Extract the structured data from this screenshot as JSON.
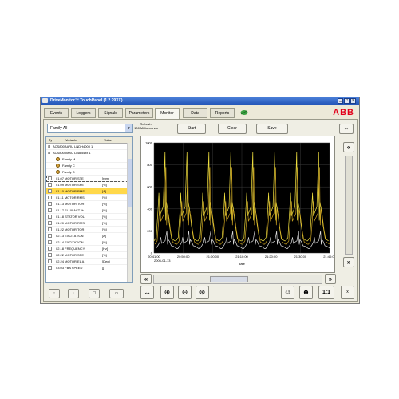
{
  "window": {
    "title": "DriveMonitor™ TouchPanel (1.2.29XX)"
  },
  "tabs": [
    "Events",
    "Loggers",
    "Signals",
    "Parameters",
    "Monitor",
    "Data",
    "Reports"
  ],
  "active_tab": "Monitor",
  "brand": "ABB",
  "toolbar": {
    "family_select": "Family All",
    "refresh_label_1": "Refresh:",
    "refresh_label_2": "100 Milliseconds",
    "start": "Start",
    "clear": "Clear",
    "save": "Save",
    "link_icon": "link-icon"
  },
  "tree": {
    "headers": {
      "type": "Ty",
      "variable": "Variable",
      "value": "Value"
    },
    "groups": [
      {
        "label": "ACS800BARU LNDH4000 1"
      },
      {
        "label": "ACS8000MXU LMAB4xx 1"
      }
    ],
    "families": [
      "Family M",
      "Family C",
      "Family S"
    ],
    "rows": [
      {
        "var": "01.07 MOTOR STE",
        "val": "[rpm]"
      },
      {
        "var": "01.09 MOTOR SPE",
        "val": "[%]"
      },
      {
        "var": "01.10 MOTOR RMS",
        "val": "[A]"
      },
      {
        "var": "01.11 MOTOR RMS",
        "val": "[%]"
      },
      {
        "var": "01.13 MOTOR TOR",
        "val": "[%]"
      },
      {
        "var": "01.17 FLUX ACT %",
        "val": "[%]"
      },
      {
        "var": "01.18 STATOR VOL",
        "val": "[%]"
      },
      {
        "var": "01.20 MOTOR RMS",
        "val": "[%]"
      },
      {
        "var": "01.22 MOTOR TOR",
        "val": "[%]"
      },
      {
        "var": "02.13 EXCITATION",
        "val": "[A]"
      },
      {
        "var": "02.14 EXCITATION",
        "val": "[%]"
      },
      {
        "var": "02.18 FREQUENCY",
        "val": "[Hz]"
      },
      {
        "var": "02.22 MOTOR SPE",
        "val": "[%]"
      },
      {
        "var": "02.24 MOTOR EL A",
        "val": "[Deg]"
      },
      {
        "var": "03.03 FBA SPEED",
        "val": "[]"
      }
    ]
  },
  "chart_data": {
    "type": "line",
    "background": "#000000",
    "grid": true,
    "ylim": [
      0,
      1000
    ],
    "ytick_labels": [
      "0",
      "200",
      "400",
      "600",
      "800",
      "1000"
    ],
    "xtick_labels": [
      "20:41:00",
      "20:50:00",
      "21:00:00",
      "21:10:00",
      "21:20:00",
      "21:30:00",
      "21:40:00"
    ],
    "date_label": "2006-01-13",
    "xlabel": "date",
    "series": [
      {
        "color": "#f0e040",
        "cycles": 8,
        "peak": 920,
        "plateau": 420,
        "trough": 110
      },
      {
        "color": "#c8a020",
        "cycles": 8,
        "peak": 780,
        "plateau": 360,
        "trough": 80
      },
      {
        "color": "#dddddd",
        "cycles": 8,
        "peak": 200,
        "plateau": 110,
        "trough": 40
      }
    ]
  },
  "bottom_toolbar": {
    "icons": [
      "arrow-up-icon",
      "arrow-down-icon",
      "edit-icon",
      "properties-icon",
      "fit-horizontal-icon",
      "zoom-in-icon",
      "zoom-out-icon",
      "zoom-area-icon",
      "person-icon",
      "person-outline-icon"
    ],
    "ratio_label": "1:1",
    "small_label": "x"
  },
  "colors": {
    "accent": "#e2001a",
    "selected_row": "#ffd84a",
    "titlebar": "#2f62c4"
  }
}
